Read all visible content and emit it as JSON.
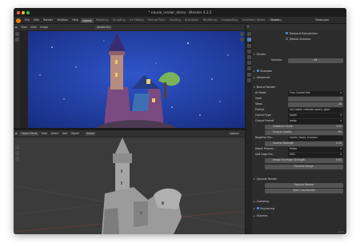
{
  "window": {
    "title": "* neural_render_demo - Blender 4.3.2"
  },
  "menu": {
    "items": [
      "File",
      "Edit",
      "Render",
      "Window",
      "Help"
    ],
    "workspaces": [
      "Layout",
      "Modeling",
      "Sculpting",
      "UV Editing",
      "Texture Paint",
      "Shading",
      "Animation",
      "Rendering",
      "Compositing",
      "Geometry Nodes",
      "Scripting"
    ],
    "scene": "Scene",
    "view_layer": "ViewLayer"
  },
  "render_header": {
    "view": "View",
    "view2": "View",
    "image": "Image",
    "slot": "render.001"
  },
  "viewport_header": {
    "mode": "Object Mode",
    "view": "View",
    "select": "Select",
    "add": "Add",
    "object": "Object",
    "orientation": "Global",
    "options": "Options"
  },
  "props": {
    "temporal_reprojection": "Temporal Reprojection",
    "jittered_shadows": "Jittered Shadows",
    "render_section": "Render",
    "samples_label": "Samples",
    "samples_value": "64",
    "shadows": "Shadows",
    "advanced": "Advanced",
    "neural_render": "Neural Render",
    "ai_model_label": "AI Model",
    "ai_model_value": "Flux Control Net",
    "seed_label": "Seed",
    "seed_value": "1",
    "steps_label": "Steps",
    "steps_value": "28",
    "prompt_label": "Prompt",
    "prompt_value": "old castle, nebulae space, glare",
    "control_type_label": "Control Type",
    "control_type_value": "depth",
    "output_format_label": "Output Format",
    "output_format_value": "webp",
    "guidance_label": "Guidance Scale",
    "guidance_value": "4.50",
    "quality_label": "Output Quality",
    "quality_value": "80",
    "negative_label": "Negative Pro...",
    "negative_value": "hands, faces, humans",
    "control_strength_label": "Control Strength",
    "control_strength_value": "0.50",
    "depth_label": "Depth Preproc...",
    "depth_value": "Midas",
    "soft_edge_label": "Soft Edge Pre...",
    "soft_edge_value": "HED",
    "i2i_label": "Image To Image Strength",
    "i2i_value": "0.63",
    "preview_button": "Preview Image",
    "upscale_section": "Upscale Render",
    "upscale_button": "Upscale Render",
    "open_last_button": "Open Last Render",
    "clamping": "Clamping",
    "raytracing": "Raytracing",
    "volumes": "Volumes"
  },
  "status": {
    "version": "4.3.2"
  }
}
